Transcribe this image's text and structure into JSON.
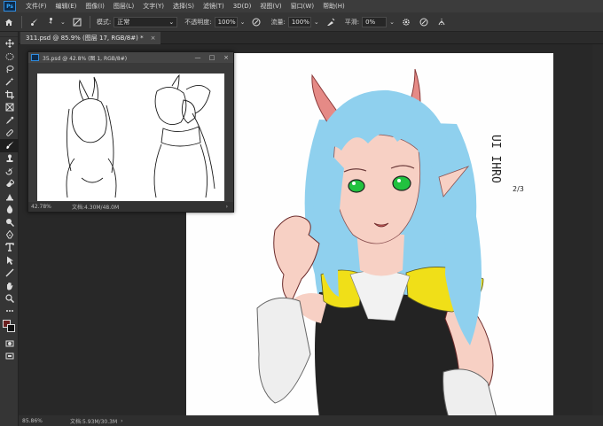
{
  "menubar": {
    "app_logo": "Ps",
    "items": [
      "文件(F)",
      "编辑(E)",
      "图像(I)",
      "图层(L)",
      "文字(Y)",
      "选择(S)",
      "滤镜(T)",
      "3D(D)",
      "视图(V)",
      "窗口(W)",
      "帮助(H)"
    ]
  },
  "options": {
    "brush_size": "4",
    "mode_label": "模式:",
    "mode_value": "正常",
    "opacity_label": "不透明度:",
    "opacity_value": "100%",
    "flow_label": "流量:",
    "flow_value": "100%",
    "smoothing_label": "平滑:",
    "smoothing_value": "0%"
  },
  "document": {
    "tab_label": "311.psd @ 85.9% (图层 17, RGB/8#) *",
    "close_glyph": "×",
    "zoom": "85.86%",
    "doc_info": "文档:5.93M/30.3M"
  },
  "float_window": {
    "title": "35.psd @ 42.8% (图 1, RGB/8#)",
    "zoom": "42.78%",
    "doc_info": "文档:4.30M/48.0M",
    "ctrl_min": "—",
    "ctrl_max": "□",
    "ctrl_close": "×"
  },
  "artwork": {
    "signature": "UI IHRO",
    "date_note": "2/3"
  },
  "colors": {
    "foreground": "#6b1f1f",
    "background": "#111111",
    "hair": "#8fd0ee",
    "skin": "#f7d0c4",
    "horn": "#e58a86",
    "eyes": "#22c23f",
    "collar": "#f0df18",
    "dress": "#232323"
  },
  "tools": [
    "move-tool-icon",
    "marquee-tool-icon",
    "lasso-tool-icon",
    "magic-wand-icon",
    "crop-tool-icon",
    "frame-tool-icon",
    "eyedropper-icon",
    "healing-brush-icon",
    "brush-tool-icon",
    "clone-stamp-icon",
    "history-brush-icon",
    "eraser-icon",
    "gradient-tool-icon",
    "blur-tool-icon",
    "dodge-tool-icon",
    "pen-tool-icon",
    "type-tool-icon",
    "path-select-icon",
    "shape-tool-icon",
    "hand-tool-icon",
    "zoom-tool-icon",
    "more-tools-icon"
  ]
}
